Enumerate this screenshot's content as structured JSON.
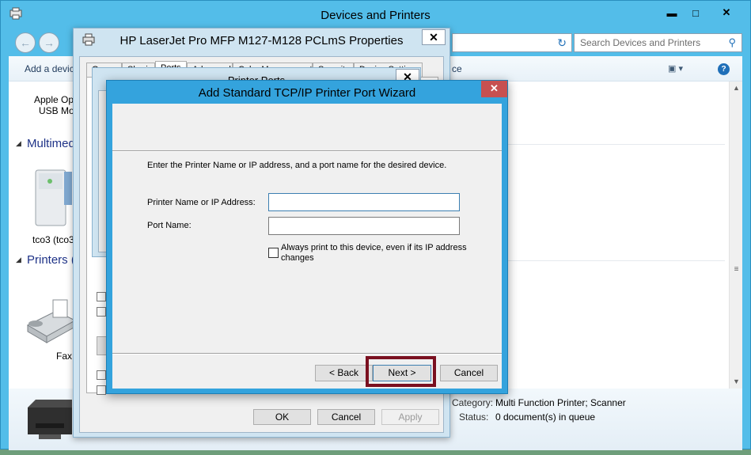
{
  "main_window": {
    "title": "Devices and Printers",
    "controls": {
      "minimize": "▬",
      "maximize": "□",
      "close": "✕"
    },
    "search_placeholder": "Search Devices and Printers",
    "command_bar": {
      "add_device": "Add a devic",
      "partial_text": "ce"
    },
    "devices": [
      {
        "label_line1": "Apple Op",
        "label_line2": "USB Mou"
      },
      {
        "label": "tco3 (tco3"
      },
      {
        "label": "Fax"
      }
    ],
    "groups": [
      {
        "label": "Multimed"
      },
      {
        "label": "Printers ("
      }
    ],
    "details": {
      "category_label": "Category:",
      "category_value": "Multi Function Printer; Scanner",
      "status_label": "Status:",
      "status_value": "0 document(s) in queue"
    }
  },
  "properties_dialog": {
    "title": "HP LaserJet Pro MFP M127-M128 PCLmS Properties",
    "close": "✕",
    "tabs": [
      "General",
      "Sharing",
      "Ports",
      "Advanced",
      "Color Management",
      "Security",
      "Device Settings"
    ],
    "active_tab": "Ports",
    "buttons": {
      "ok": "OK",
      "cancel": "Cancel",
      "apply": "Apply"
    }
  },
  "ports_dialog": {
    "title": "Printer Ports",
    "close": "✕"
  },
  "wizard": {
    "title": "Add Standard TCP/IP Printer Port Wizard",
    "close": "✕",
    "instruction": "Enter the Printer Name or IP address, and a port name for the desired device.",
    "fields": {
      "printer_name_label": "Printer Name or IP Address:",
      "printer_name_value": "",
      "port_name_label": "Port Name:",
      "port_name_value": ""
    },
    "checkbox": {
      "label_line1": "Always print to this device, even if its IP address",
      "label_line2": "changes",
      "checked": false
    },
    "buttons": {
      "back": "< Back",
      "next": "Next >",
      "cancel": "Cancel"
    }
  },
  "colors": {
    "accent_blue": "#34a3dd",
    "close_red": "#c75050",
    "highlight": "#7a1020",
    "link_blue": "#1e3287"
  }
}
